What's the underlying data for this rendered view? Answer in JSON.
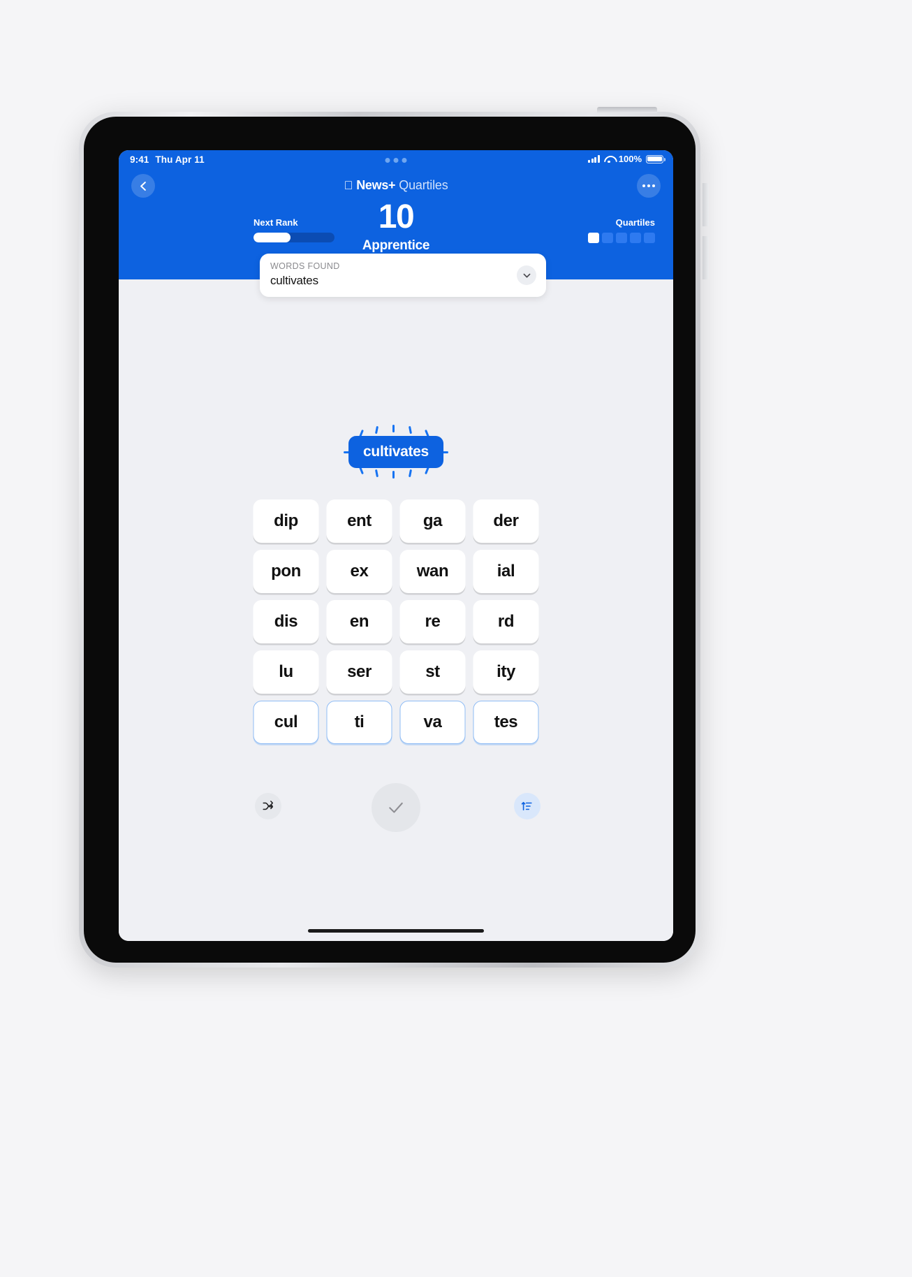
{
  "device": {
    "name": "ipad",
    "status_bar": {
      "time": "9:41",
      "date": "Thu Apr 11",
      "battery_percent": "100%",
      "signal_icon": "cellular-signal-icon",
      "wifi_icon": "wifi-icon",
      "battery_icon": "battery-full-icon",
      "dynamic_dots_icon": "live-activity-dots-icon"
    }
  },
  "header": {
    "back_icon": "chevron-left-icon",
    "more_icon": "ellipsis-icon",
    "brand": {
      "apple_logo": "apple-logo-icon",
      "news_plus": "News+",
      "app_name": "Quartiles"
    },
    "score": {
      "value": "10",
      "rank_label": "Apprentice"
    },
    "next_rank": {
      "label": "Next Rank",
      "progress_percent": 46
    },
    "quartiles": {
      "label": "Quartiles",
      "pips": [
        "on",
        "off",
        "off",
        "off",
        "off"
      ]
    }
  },
  "words_found_card": {
    "label": "WORDS FOUND",
    "latest_word": "cultivates",
    "expand_icon": "chevron-down-icon"
  },
  "board": {
    "found_word_pill": "cultivates",
    "tiles": [
      {
        "text": "dip",
        "selected": false
      },
      {
        "text": "ent",
        "selected": false
      },
      {
        "text": "ga",
        "selected": false
      },
      {
        "text": "der",
        "selected": false
      },
      {
        "text": "pon",
        "selected": false
      },
      {
        "text": "ex",
        "selected": false
      },
      {
        "text": "wan",
        "selected": false
      },
      {
        "text": "ial",
        "selected": false
      },
      {
        "text": "dis",
        "selected": false
      },
      {
        "text": "en",
        "selected": false
      },
      {
        "text": "re",
        "selected": false
      },
      {
        "text": "rd",
        "selected": false
      },
      {
        "text": "lu",
        "selected": false
      },
      {
        "text": "ser",
        "selected": false
      },
      {
        "text": "st",
        "selected": false
      },
      {
        "text": "ity",
        "selected": false
      },
      {
        "text": "cul",
        "selected": true
      },
      {
        "text": "ti",
        "selected": true
      },
      {
        "text": "va",
        "selected": true
      },
      {
        "text": "tes",
        "selected": true
      }
    ]
  },
  "controls": {
    "shuffle_icon": "shuffle-icon",
    "submit_icon": "checkmark-icon",
    "sort_icon": "sort-list-icon"
  },
  "colors": {
    "brand_blue": "#0d62e0",
    "page_bg": "#eff0f4",
    "tile_selected_border": "#8fbcf5",
    "progress_track": "#0b4cb3",
    "pip_off": "#2e7af0",
    "desktop_bg": "#f5f5f7"
  }
}
